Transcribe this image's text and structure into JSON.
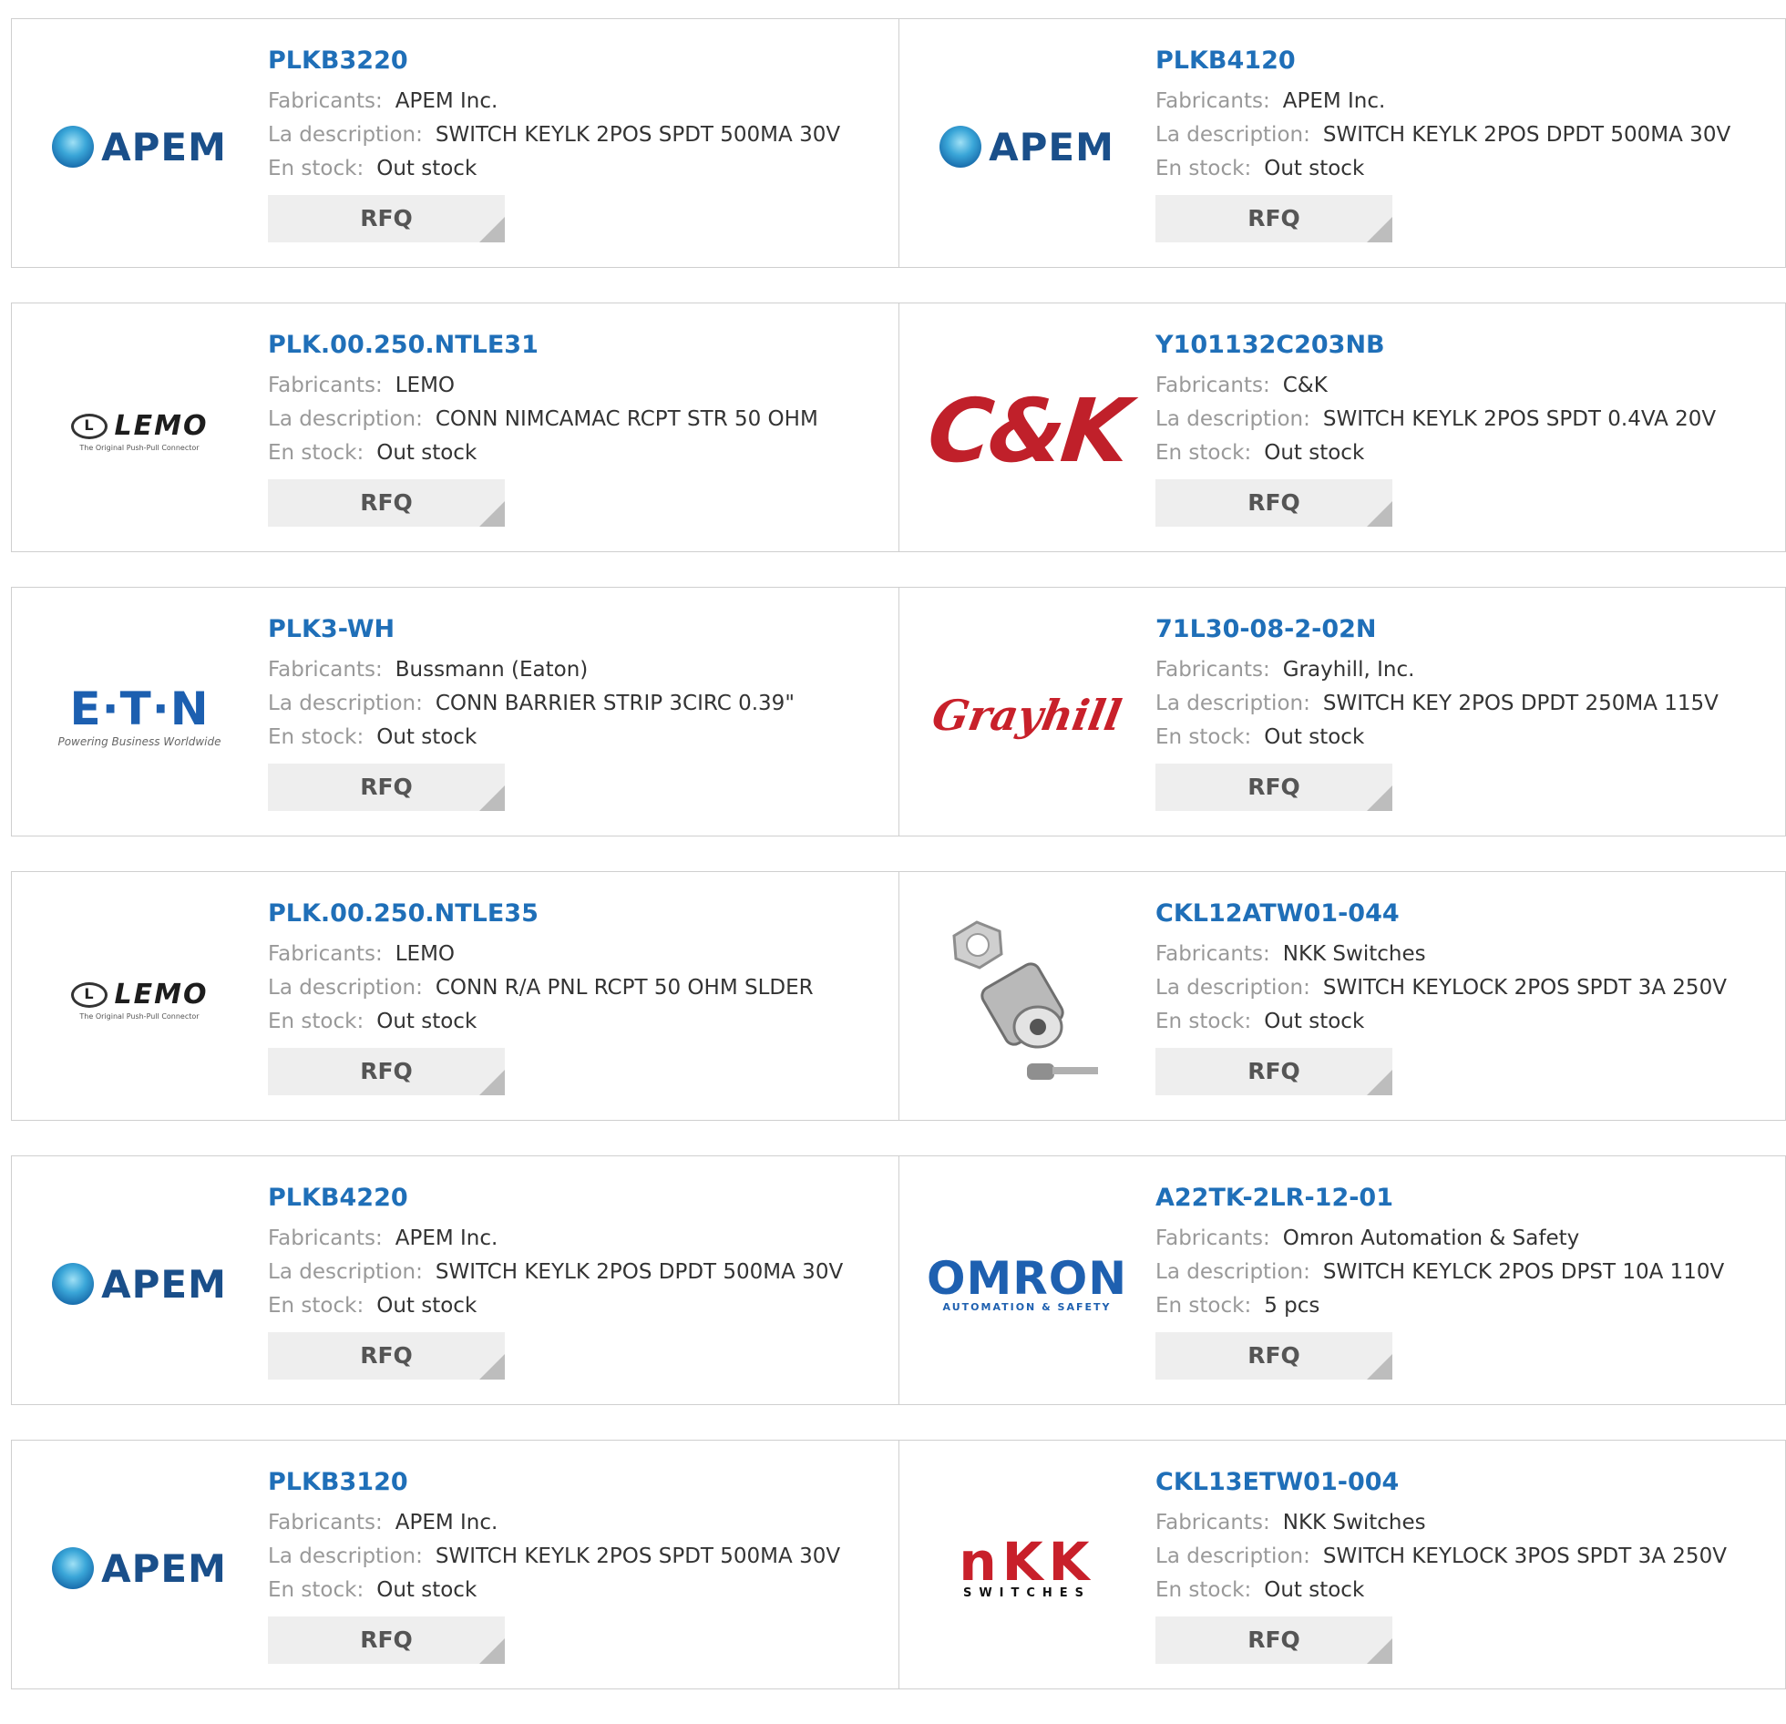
{
  "labels": {
    "manufacturer": "Fabricants:",
    "description": "La description:",
    "stock": "En stock:",
    "rfq": "RFQ"
  },
  "logos": {
    "apem": "APEM",
    "lemo": "LEMO",
    "lemo_tagline": "The Original Push-Pull Connector",
    "ck": "C&K",
    "eaton": "E·T·N",
    "eaton_tagline": "Powering Business Worldwide",
    "grayhill": "Grayhill",
    "omron": "OMRON",
    "omron_tagline": "AUTOMATION & SAFETY",
    "nkk": "nKK",
    "nkk_tagline": "SWITCHES"
  },
  "products": [
    {
      "part": "PLKB3220",
      "manufacturer": "APEM Inc.",
      "description": "SWITCH KEYLK 2POS SPDT 500MA 30V",
      "stock": "Out stock",
      "logo": "apem"
    },
    {
      "part": "PLKB4120",
      "manufacturer": "APEM Inc.",
      "description": "SWITCH KEYLK 2POS DPDT 500MA 30V",
      "stock": "Out stock",
      "logo": "apem"
    },
    {
      "part": "PLK.00.250.NTLE31",
      "manufacturer": "LEMO",
      "description": "CONN NIMCAMAC RCPT STR 50 OHM",
      "stock": "Out stock",
      "logo": "lemo"
    },
    {
      "part": "Y101132C203NB",
      "manufacturer": "C&K",
      "description": "SWITCH KEYLK 2POS SPDT 0.4VA 20V",
      "stock": "Out stock",
      "logo": "ck"
    },
    {
      "part": "PLK3-WH",
      "manufacturer": "Bussmann (Eaton)",
      "description": "CONN BARRIER STRIP 3CIRC 0.39\"",
      "stock": "Out stock",
      "logo": "eaton"
    },
    {
      "part": "71L30-08-2-02N",
      "manufacturer": "Grayhill, Inc.",
      "description": "SWITCH KEY 2POS DPDT 250MA 115V",
      "stock": "Out stock",
      "logo": "grayhill"
    },
    {
      "part": "PLK.00.250.NTLE35",
      "manufacturer": "LEMO",
      "description": "CONN R/A PNL RCPT 50 OHM SLDER",
      "stock": "Out stock",
      "logo": "lemo"
    },
    {
      "part": "CKL12ATW01-044",
      "manufacturer": "NKK Switches",
      "description": "SWITCH KEYLOCK 2POS SPDT 3A 250V",
      "stock": "Out stock",
      "logo": "photo"
    },
    {
      "part": "PLKB4220",
      "manufacturer": "APEM Inc.",
      "description": "SWITCH KEYLK 2POS DPDT 500MA 30V",
      "stock": "Out stock",
      "logo": "apem"
    },
    {
      "part": "A22TK-2LR-12-01",
      "manufacturer": "Omron Automation & Safety",
      "description": "SWITCH KEYLCK 2POS DPST 10A 110V",
      "stock": "5 pcs",
      "logo": "omron"
    },
    {
      "part": "PLKB3120",
      "manufacturer": "APEM Inc.",
      "description": "SWITCH KEYLK 2POS SPDT 500MA 30V",
      "stock": "Out stock",
      "logo": "apem"
    },
    {
      "part": "CKL13ETW01-004",
      "manufacturer": "NKK Switches",
      "description": "SWITCH KEYLOCK 3POS SPDT 3A 250V",
      "stock": "Out stock",
      "logo": "nkk"
    }
  ]
}
